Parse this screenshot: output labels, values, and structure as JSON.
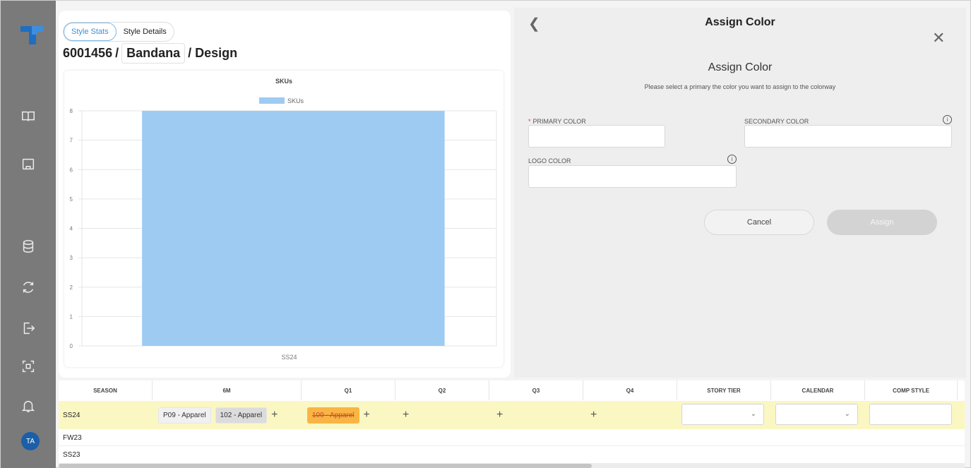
{
  "sidebar": {
    "icons": [
      "app-logo-icon",
      "book-icon",
      "laptop-icon",
      "database-icon",
      "refresh-icon",
      "export-icon",
      "scan-icon",
      "bell-icon"
    ],
    "avatar_initials": "TA",
    "brand_color": "#1a5fa8"
  },
  "left": {
    "tabs": [
      {
        "label": "Style Stats",
        "active": true
      },
      {
        "label": "Style Details",
        "active": false
      }
    ],
    "title_id": "6001456",
    "title_sep": "/",
    "title_chip": "Bandana",
    "title_tail": "/ Design"
  },
  "chart_data": {
    "type": "bar",
    "title": "SKUs",
    "categories": [
      "SS24"
    ],
    "series": [
      {
        "name": "SKUs",
        "values": [
          8
        ],
        "color": "#9ecbf2"
      }
    ],
    "ylim": [
      0,
      8
    ],
    "yticks": [
      "0",
      "1",
      "2",
      "3",
      "4",
      "5",
      "6",
      "7",
      "8"
    ],
    "legend": "top-center",
    "grid": true
  },
  "panel": {
    "header_title": "Assign Color",
    "dialog_title": "Assign Color",
    "subtitle": "Please select a primary the color you want to assign to the colorway",
    "primary_label": "PRIMARY COLOR",
    "secondary_label": "SECONDARY COLOR",
    "logo_label": "LOGO COLOR",
    "cancel_label": "Cancel",
    "assign_label": "Assign"
  },
  "table": {
    "headers": [
      "SEASON",
      "6M",
      "Q1",
      "Q2",
      "Q3",
      "Q4",
      "STORY TIER",
      "CALENDAR",
      "COMP STYLE"
    ],
    "rows": [
      {
        "season": "SS24",
        "m6": [
          "P09 - Apparel",
          "102 - Apparel"
        ],
        "q1": [
          "109 - Apparel"
        ]
      },
      {
        "season": "FW23"
      },
      {
        "season": "SS23"
      }
    ]
  }
}
